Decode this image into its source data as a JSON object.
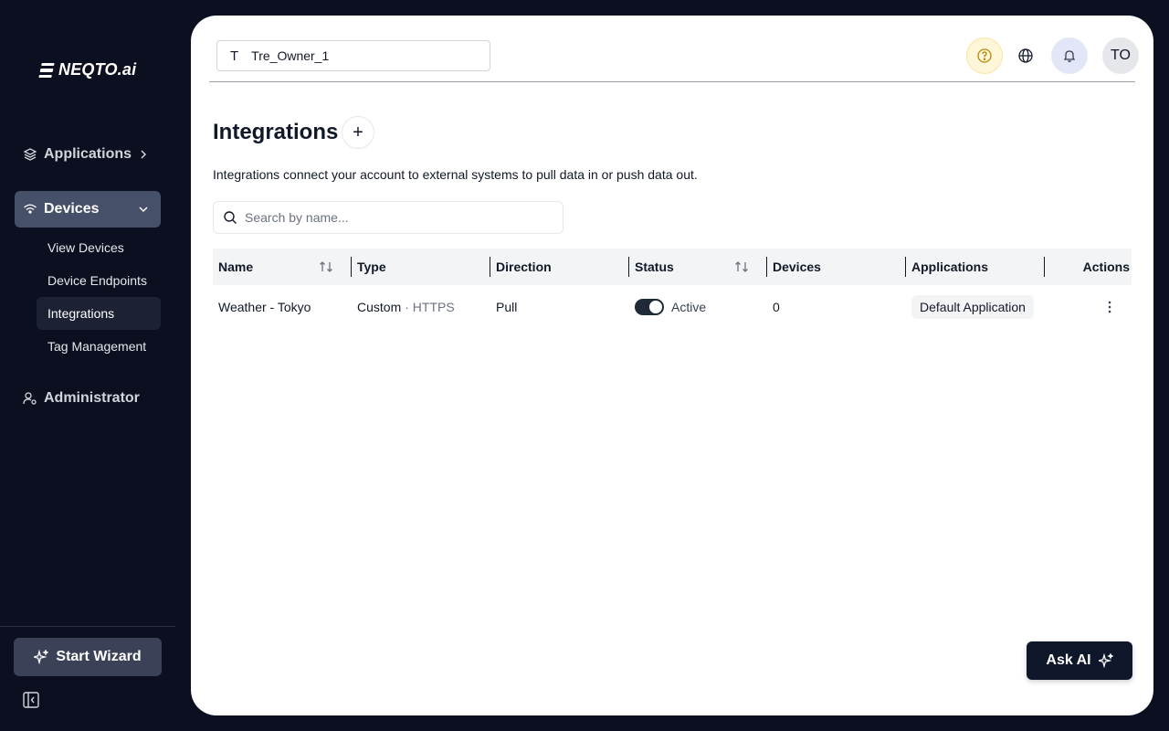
{
  "app": {
    "logo_text": "NEQTO.ai"
  },
  "sidebar": {
    "applications": {
      "label": "Applications",
      "icon": "layers-icon"
    },
    "devices": {
      "label": "Devices",
      "icon": "wifi-icon"
    },
    "sub_items": [
      {
        "label": "View Devices"
      },
      {
        "label": "Device Endpoints"
      },
      {
        "label": "Integrations"
      },
      {
        "label": "Tag Management"
      }
    ],
    "administrator": {
      "label": "Administrator",
      "icon": "user-gear-icon"
    },
    "start_wizard": {
      "label": "Start Wizard",
      "icon": "sparkle-icon"
    },
    "collapse_icon": "sidebar-collapse-icon"
  },
  "topbar": {
    "tenant": {
      "initial": "T",
      "name": "Tre_Owner_1"
    },
    "avatar_initials": "TO"
  },
  "page": {
    "title": "Integrations",
    "add_label": "+",
    "description": "Integrations connect your account to external systems to pull data in or push data out.",
    "search": {
      "placeholder": "Search by name..."
    }
  },
  "table": {
    "headers": {
      "name": "Name",
      "type": "Type",
      "direction": "Direction",
      "status": "Status",
      "devices": "Devices",
      "applications": "Applications",
      "actions": "Actions"
    },
    "rows": [
      {
        "name": "Weather - Tokyo",
        "type": "Custom",
        "type_sub": "· HTTPS",
        "direction": "Pull",
        "status": "Active",
        "devices": "0",
        "application": "Default Application"
      }
    ]
  },
  "ask_ai": {
    "label": "Ask AI"
  },
  "colors": {
    "sidebar_bg": "#0c0f1f",
    "active_nav": "#475069",
    "button_dark": "#0f172a",
    "help_bg": "#fef6d8",
    "bell_bg": "#e3e6f6"
  }
}
